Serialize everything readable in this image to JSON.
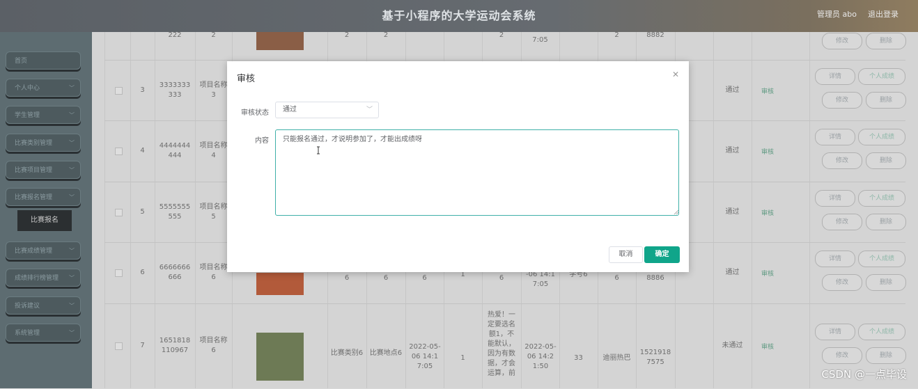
{
  "header": {
    "title": "基于小程序的大学运动会系统",
    "user": "管理员 abo",
    "logout": "退出登录"
  },
  "sidebar": {
    "items": [
      {
        "label": "首页",
        "has_arrow": false
      },
      {
        "label": "个人中心",
        "has_arrow": true
      },
      {
        "label": "学生管理",
        "has_arrow": true
      },
      {
        "label": "比赛类别管理",
        "has_arrow": true
      },
      {
        "label": "比赛项目管理",
        "has_arrow": true
      },
      {
        "label": "比赛报名管理",
        "has_arrow": true
      },
      {
        "label": "比赛成绩管理",
        "has_arrow": true
      },
      {
        "label": "成绩排行榜管理",
        "has_arrow": true
      },
      {
        "label": "投诉建议",
        "has_arrow": true
      },
      {
        "label": "系统管理",
        "has_arrow": true
      }
    ],
    "active_sub": "比赛报名"
  },
  "table": {
    "buttons": {
      "detail": "详情",
      "score": "个人成绩",
      "edit": "修改",
      "delete": "删除",
      "audit": "审核"
    },
    "top_row": {
      "c1": "222",
      "c2": "2",
      "c3": "2",
      "c4": "2",
      "c5": "2",
      "c6": "7:05",
      "c7": "2",
      "c8": "8882"
    },
    "rows": [
      {
        "idx": "3",
        "num": "3333333333",
        "proj": "项目名称3",
        "status": "通过"
      },
      {
        "idx": "4",
        "num": "4444444444",
        "proj": "项目名称4",
        "status": "通过"
      },
      {
        "idx": "5",
        "num": "5555555555",
        "proj": "项目名称5",
        "status": "通过"
      },
      {
        "idx": "6",
        "num": "6666666666",
        "proj": "项目名称6",
        "c1": "6",
        "c2": "6",
        "c3": "6",
        "c4": "1",
        "c5": "6",
        "time": "-06 14:17:05",
        "name": "学号6",
        "c6": "6",
        "phone": "8886",
        "status": "通过"
      },
      {
        "idx": "7",
        "num": "1651818110967",
        "proj": "项目名称6",
        "cat": "比赛类别6",
        "place": "比赛地点6",
        "date": "2022-05-06 14:17:05",
        "count": "1",
        "notice": "热爱！一定要选名额1，不能默认，因为有数据，才会运算，前",
        "date2": "2022-05-06 14:21:50",
        "sid": "33",
        "name": "迪丽热巴",
        "phone": "15219187575",
        "status": "未通过"
      }
    ]
  },
  "dialog": {
    "title": "审核",
    "status_label": "审核状态",
    "status_value": "通过",
    "content_label": "内容",
    "content_value": "只能报名通过，才说明参加了，才能出成绩呀",
    "cancel": "取消",
    "confirm": "确定"
  },
  "watermark": "CSDN @一点毕设"
}
